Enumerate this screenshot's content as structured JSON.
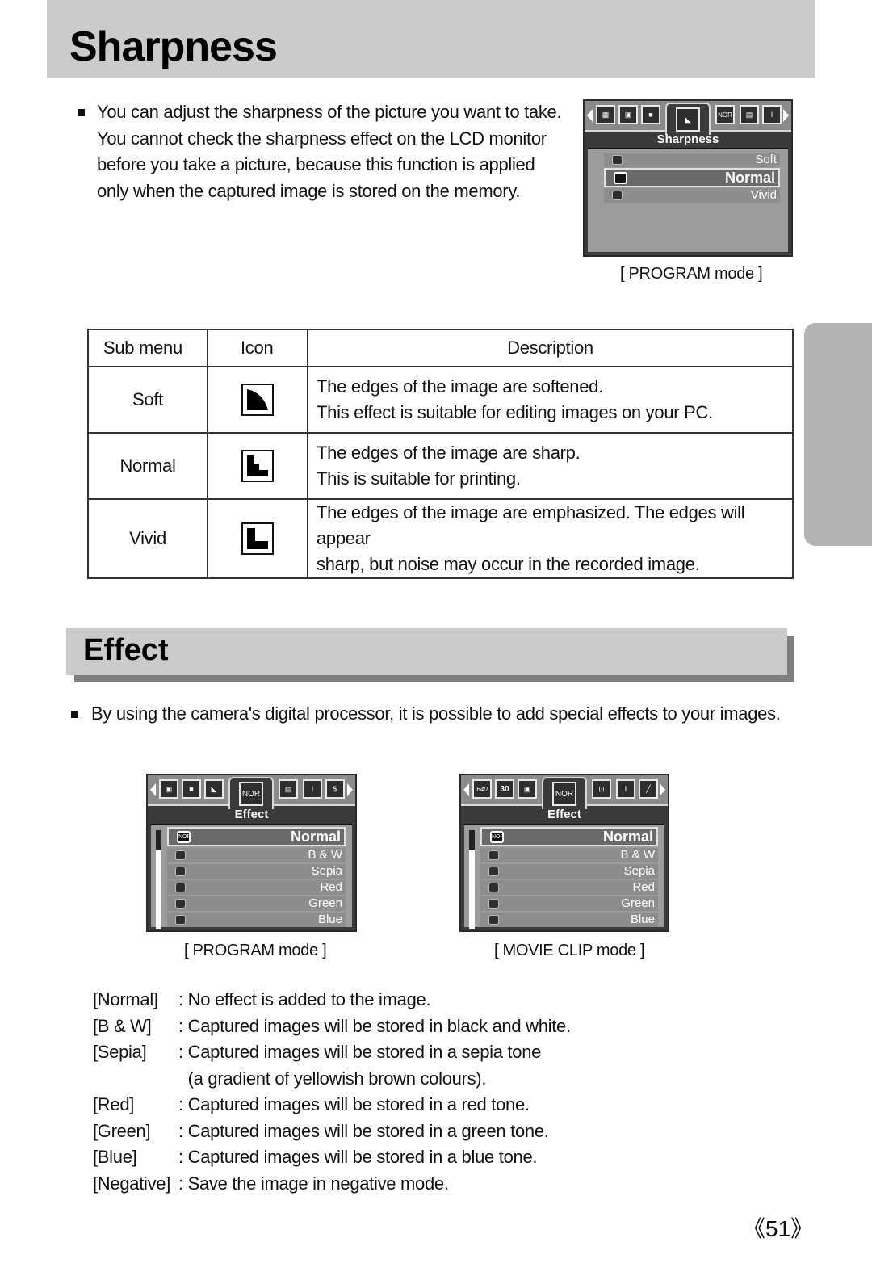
{
  "sharpness_section": {
    "title": "Sharpness",
    "intro_lines": [
      "You can adjust the sharpness of the picture you want to take.",
      "You cannot check the sharpness effect on the LCD monitor",
      "before you take a picture, because this function is applied",
      "only when the captured image is stored on the memory."
    ],
    "lcd": {
      "menu_title": "Sharpness",
      "tab_icons": [
        "grid-icon",
        "frame-icon",
        "square-icon",
        "sharpness-icon",
        "nor-icon",
        "photo-icon",
        "bracket-icon"
      ],
      "nor_label": "NOR",
      "options": [
        {
          "label": "Soft",
          "selected": false
        },
        {
          "label": "Normal",
          "selected": true
        },
        {
          "label": "Vivid",
          "selected": false
        }
      ],
      "caption": "[ PROGRAM mode ]"
    },
    "table": {
      "headers": [
        "Sub menu",
        "Icon",
        "Description"
      ],
      "rows": [
        {
          "name": "Soft",
          "icon": "sharpness-soft-icon",
          "desc": [
            "The edges of the image are softened.",
            "This effect is suitable for editing images on your PC."
          ]
        },
        {
          "name": "Normal",
          "icon": "sharpness-normal-icon",
          "desc": [
            "The edges of the image are sharp.",
            "This is suitable for printing."
          ]
        },
        {
          "name": "Vivid",
          "icon": "sharpness-vivid-icon",
          "desc": [
            "The edges of the image are emphasized. The edges will appear",
            "sharp, but noise may occur in the recorded image."
          ]
        }
      ]
    }
  },
  "effect_section": {
    "title": "Effect",
    "intro": "By using the camera's digital processor, it is possible to add special effects to your images.",
    "lcd_program": {
      "menu_title": "Effect",
      "nor_label": "NOR",
      "options": [
        "Normal",
        "B & W",
        "Sepia",
        "Red",
        "Green",
        "Blue"
      ],
      "selected": "Normal",
      "caption": "[ PROGRAM mode ]"
    },
    "lcd_movie": {
      "menu_title": "Effect",
      "nor_label": "NOR",
      "tab_labels": [
        "640",
        "30"
      ],
      "options": [
        "Normal",
        "B & W",
        "Sepia",
        "Red",
        "Green",
        "Blue"
      ],
      "selected": "Normal",
      "caption": "[ MOVIE CLIP mode ]"
    },
    "definitions": [
      {
        "key": "[Normal]",
        "value": ": No effect is added to the image."
      },
      {
        "key": "[B & W]",
        "value": ": Captured images will be stored in black and white."
      },
      {
        "key": "[Sepia]",
        "value": ": Captured images will be stored in a sepia tone"
      },
      {
        "key": "",
        "value": "  (a gradient of yellowish brown colours)."
      },
      {
        "key": "[Red]",
        "value": ": Captured images will be stored in a red tone."
      },
      {
        "key": "[Green]",
        "value": ": Captured images will be stored in a green tone."
      },
      {
        "key": "[Blue]",
        "value": ": Captured images will be stored in a blue tone."
      },
      {
        "key": "[Negative]",
        "value": ": Save the image in negative mode."
      }
    ]
  },
  "page_number": "《51》"
}
